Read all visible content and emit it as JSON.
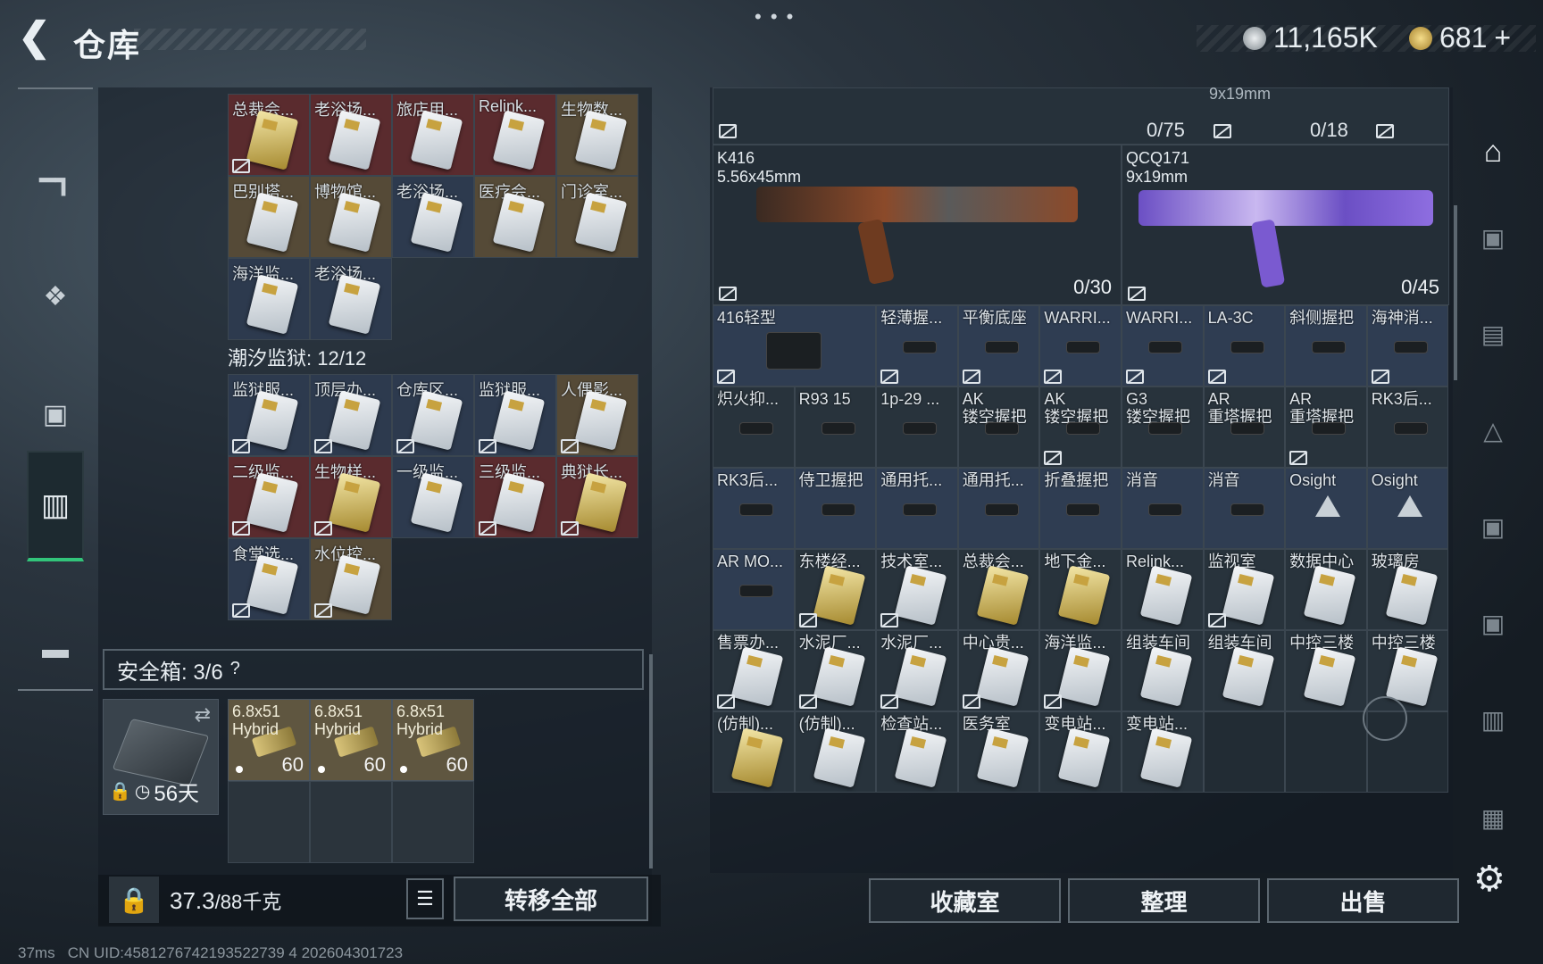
{
  "header": {
    "title": "仓库",
    "currency1": "11,165K",
    "currency2": "681",
    "plus": "+"
  },
  "colors": {
    "accent_green": "#32c47a",
    "card_red": "#5a2b2e",
    "card_gold": "#554a37",
    "card_blue": "#2d3a4e"
  },
  "left_top_grid": [
    {
      "label": "总裁会...",
      "bg": "red",
      "gold": true,
      "nt": true
    },
    {
      "label": "老浴场...",
      "bg": "red"
    },
    {
      "label": "旅店用...",
      "bg": "red"
    },
    {
      "label": "Relink...",
      "bg": "red"
    },
    {
      "label": "生物数...",
      "bg": "gold"
    },
    {
      "label": "巴别塔...",
      "bg": "gold"
    },
    {
      "label": "博物馆...",
      "bg": "gold"
    },
    {
      "label": "老浴场...",
      "bg": "blue"
    },
    {
      "label": "医疗会...",
      "bg": "gold"
    },
    {
      "label": "门诊室...",
      "bg": "gold"
    },
    {
      "label": "海洋监...",
      "bg": "blue"
    },
    {
      "label": "老浴场...",
      "bg": "blue"
    }
  ],
  "prison_section": {
    "label": "潮汐监狱: 12/12"
  },
  "prison_grid": [
    {
      "label": "监狱服...",
      "bg": "blue",
      "nt": true
    },
    {
      "label": "顶层办...",
      "bg": "blue",
      "nt": true
    },
    {
      "label": "仓库区...",
      "bg": "blue",
      "nt": true
    },
    {
      "label": "监狱服...",
      "bg": "blue",
      "nt": true
    },
    {
      "label": "人偶影...",
      "bg": "gold",
      "nt": true
    },
    {
      "label": "二级监...",
      "bg": "red",
      "nt": true
    },
    {
      "label": "生物样...",
      "bg": "red",
      "gold": true,
      "nt": true
    },
    {
      "label": "一级监...",
      "bg": "blue"
    },
    {
      "label": "三级监...",
      "bg": "red",
      "nt": true
    },
    {
      "label": "典狱长...",
      "bg": "red",
      "gold": true,
      "nt": true
    },
    {
      "label": "食堂选...",
      "bg": "blue",
      "nt": true
    },
    {
      "label": "水位控...",
      "bg": "gold",
      "nt": true
    }
  ],
  "safe_box": {
    "label": "安全箱: 3/6",
    "help": "?",
    "days": "56天"
  },
  "ammo": [
    {
      "label": "6.8x51\nHybrid",
      "count": "60"
    },
    {
      "label": "6.8x51\nHybrid",
      "count": "60"
    },
    {
      "label": "6.8x51\nHybrid",
      "count": "60"
    }
  ],
  "bottom_left": {
    "weight_value": "37.3",
    "weight_max": "/88千克",
    "transfer_label": "转移全部"
  },
  "top_row": {
    "count1": "0/75",
    "count2": "0/18",
    "caliber_partial": "9x19mm"
  },
  "weapons": [
    {
      "name": "K416",
      "caliber": "5.56x45mm",
      "ammo": "0/30"
    },
    {
      "name": "QCQ171",
      "caliber": "9x19mm",
      "ammo": "0/45"
    }
  ],
  "right_grid": [
    {
      "label": "416轻型",
      "span": 2,
      "sel": true,
      "nt": true,
      "type": "part"
    },
    {
      "label": "轻薄握...",
      "sel": true,
      "nt": true,
      "type": "part"
    },
    {
      "label": "平衡底座",
      "sel": true,
      "nt": true,
      "type": "part"
    },
    {
      "label": "WARRI...",
      "sel": true,
      "nt": true,
      "type": "part"
    },
    {
      "label": "WARRI...",
      "sel": true,
      "nt": true,
      "type": "part"
    },
    {
      "label": "LA-3C",
      "sel": true,
      "nt": true,
      "type": "part"
    },
    {
      "label": "斜侧握把",
      "sel": true,
      "type": "part"
    },
    {
      "label": "海神消...",
      "sel": true,
      "nt": true,
      "type": "part"
    },
    {
      "label": "炽火抑...",
      "type": "part"
    },
    {
      "label": "R93 15",
      "type": "part"
    },
    {
      "label": "1p-29 ...",
      "type": "part"
    },
    {
      "label": "AK\n镂空握把",
      "type": "part"
    },
    {
      "label": "AK\n镂空握把",
      "nt": true,
      "type": "part"
    },
    {
      "label": "G3\n镂空握把",
      "type": "part"
    },
    {
      "label": "AR\n重塔握把",
      "type": "part"
    },
    {
      "label": "AR\n重塔握把",
      "nt": true,
      "type": "part"
    },
    {
      "label": "RK3后...",
      "type": "part"
    },
    {
      "label": "RK3后...",
      "sel": true,
      "type": "part"
    },
    {
      "label": "侍卫握把",
      "sel": true,
      "type": "part"
    },
    {
      "label": "通用托...",
      "sel": true,
      "type": "part"
    },
    {
      "label": "通用托...",
      "sel": true,
      "type": "part"
    },
    {
      "label": "折叠握把",
      "sel": true,
      "type": "part"
    },
    {
      "label": "消音",
      "sel": true,
      "type": "part"
    },
    {
      "label": "消音",
      "sel": true,
      "type": "part"
    },
    {
      "label": "Osight",
      "sel": true,
      "type": "tri"
    },
    {
      "label": "Osight",
      "sel": true,
      "type": "tri"
    },
    {
      "label": "AR MO...",
      "sel": true,
      "type": "part"
    },
    {
      "label": "东楼经...",
      "bg": "red",
      "gold": true,
      "nt": true,
      "type": "card"
    },
    {
      "label": "技术室...",
      "bg": "red",
      "nt": true,
      "type": "card"
    },
    {
      "label": "总裁会...",
      "bg": "red",
      "gold": true,
      "type": "card"
    },
    {
      "label": "地下金...",
      "bg": "red",
      "gold": true,
      "type": "card"
    },
    {
      "label": "Relink...",
      "bg": "gold",
      "type": "card"
    },
    {
      "label": "监视室",
      "bg": "gold",
      "nt": true,
      "type": "card"
    },
    {
      "label": "数据中心",
      "bg": "gold",
      "type": "card"
    },
    {
      "label": "玻璃房",
      "bg": "gold",
      "type": "card"
    },
    {
      "label": "售票办...",
      "bg": "blue",
      "nt": true,
      "type": "card"
    },
    {
      "label": "水泥厂...",
      "bg": "blue",
      "nt": true,
      "type": "card"
    },
    {
      "label": "水泥厂...",
      "bg": "blue",
      "nt": true,
      "type": "card"
    },
    {
      "label": "中心贵...",
      "bg": "blue",
      "nt": true,
      "type": "card"
    },
    {
      "label": "海洋监...",
      "bg": "blue",
      "nt": true,
      "type": "card"
    },
    {
      "label": "组装车间",
      "bg": "blue",
      "type": "card"
    },
    {
      "label": "组装车间",
      "bg": "blue",
      "type": "card"
    },
    {
      "label": "中控三楼",
      "bg": "blue",
      "type": "card"
    },
    {
      "label": "中控三楼",
      "bg": "blue",
      "type": "card"
    },
    {
      "label": "(仿制)...",
      "bg": "blue",
      "gold": true,
      "type": "card"
    },
    {
      "label": "(仿制)...",
      "bg": "blue",
      "type": "card"
    },
    {
      "label": "检查站...",
      "bg": "blue",
      "type": "card"
    },
    {
      "label": "医务室",
      "bg": "blue",
      "type": "card"
    },
    {
      "label": "变电站...",
      "bg": "blue",
      "type": "card"
    },
    {
      "label": "变电站...",
      "bg": "blue",
      "type": "card"
    }
  ],
  "bottom_right": {
    "collection_label": "收藏室",
    "sort_label": "整理",
    "sell_label": "出售"
  },
  "right_sidebar": [
    "warehouse-icon",
    "tier-v-icon",
    "tier-iv-icon",
    "tier-iv-icon",
    "tier-iv-icon",
    "tier-v-icon",
    "tier-iv-icon",
    "tier-iv-icon"
  ],
  "footer": {
    "ping": "37ms",
    "uid": "CN UID:4581276742193522739 4 202604301723"
  }
}
